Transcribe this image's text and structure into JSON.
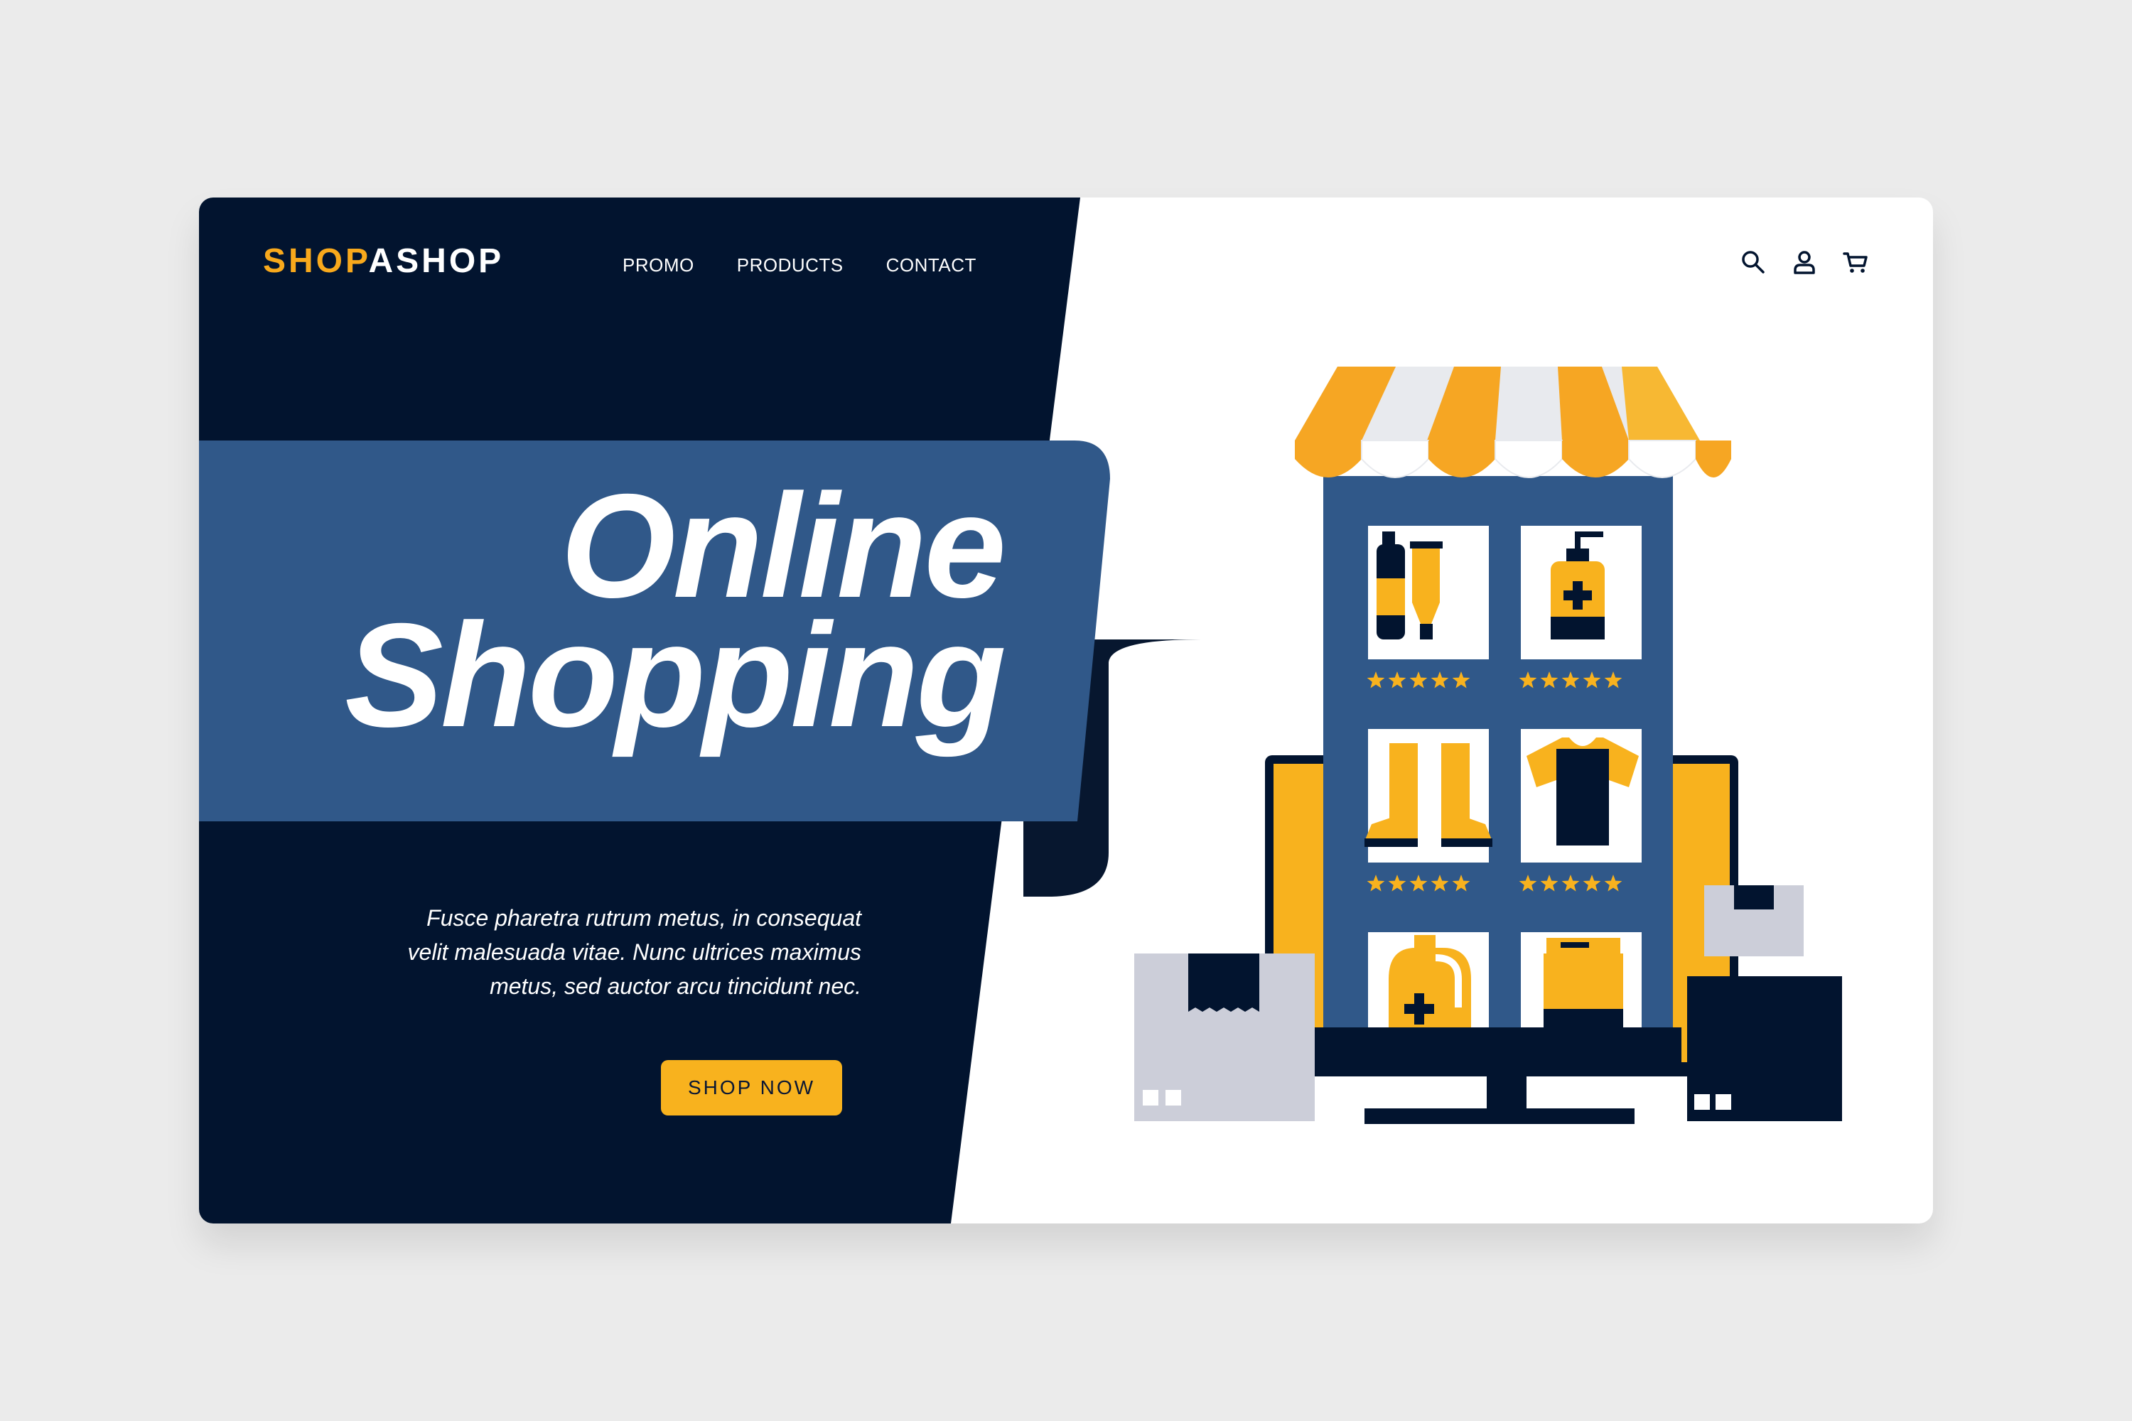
{
  "brand": {
    "part1": "SHOP",
    "part2": "ASHOP"
  },
  "nav": {
    "items": [
      "PROMO",
      "PRODUCTS",
      "CONTACT"
    ]
  },
  "header_icons": [
    "search-icon",
    "user-icon",
    "cart-icon"
  ],
  "hero": {
    "title_line1": "Online",
    "title_line2": "Shopping",
    "description_lines": [
      "Fusce pharetra rutrum metus, in consequat",
      "velit malesuada vitae. Nunc ultrices maximus",
      "metus, sed auctor arcu tincidunt nec."
    ],
    "cta_label": "SHOP NOW"
  },
  "illustration": {
    "subject": "shop-storefront",
    "product_tiles": [
      "bottle-tube-icon",
      "pump-bottle-icon",
      "boots-icon",
      "tshirt-icon",
      "jug-icon",
      "jar-icon"
    ],
    "ratings_stars": [
      5,
      5,
      5,
      5
    ]
  },
  "colors": {
    "navy": "#02142f",
    "blue": "#305889",
    "accent": "#f8b21e",
    "awning_orange": "#f6a623",
    "light_gray": "#e8eaee",
    "box_gray": "#ccced9",
    "white": "#ffffff"
  }
}
